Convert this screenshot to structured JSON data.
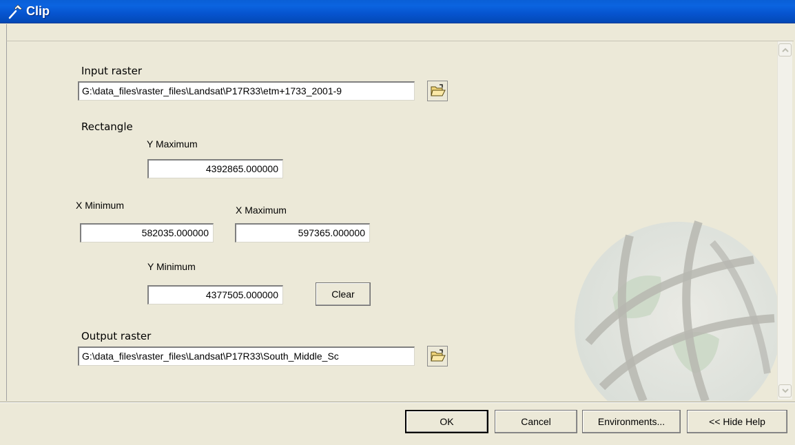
{
  "window": {
    "title": "Clip",
    "title_icon": "hammer-icon"
  },
  "form": {
    "input_raster": {
      "label": "Input raster",
      "value": "G:\\data_files\\raster_files\\Landsat\\P17R33\\etm+1733_2001-9",
      "browse_icon": "open-folder-icon"
    },
    "rectangle": {
      "label": "Rectangle",
      "y_max": {
        "label": "Y Maximum",
        "value": "4392865.000000"
      },
      "x_min": {
        "label": "X Minimum",
        "value": "582035.000000"
      },
      "x_max": {
        "label": "X Maximum",
        "value": "597365.000000"
      },
      "y_min": {
        "label": "Y Minimum",
        "value": "4377505.000000"
      },
      "clear_label": "Clear"
    },
    "output_raster": {
      "label": "Output raster",
      "value": "G:\\data_files\\raster_files\\Landsat\\P17R33\\South_Middle_Sc",
      "browse_icon": "open-folder-icon"
    }
  },
  "footer": {
    "ok_label": "OK",
    "cancel_label": "Cancel",
    "environments_label": "Environments...",
    "hide_help_label": "<< Hide Help"
  },
  "colors": {
    "titlebar": "#0b5ed8",
    "dialog_bg": "#ece9d8"
  }
}
